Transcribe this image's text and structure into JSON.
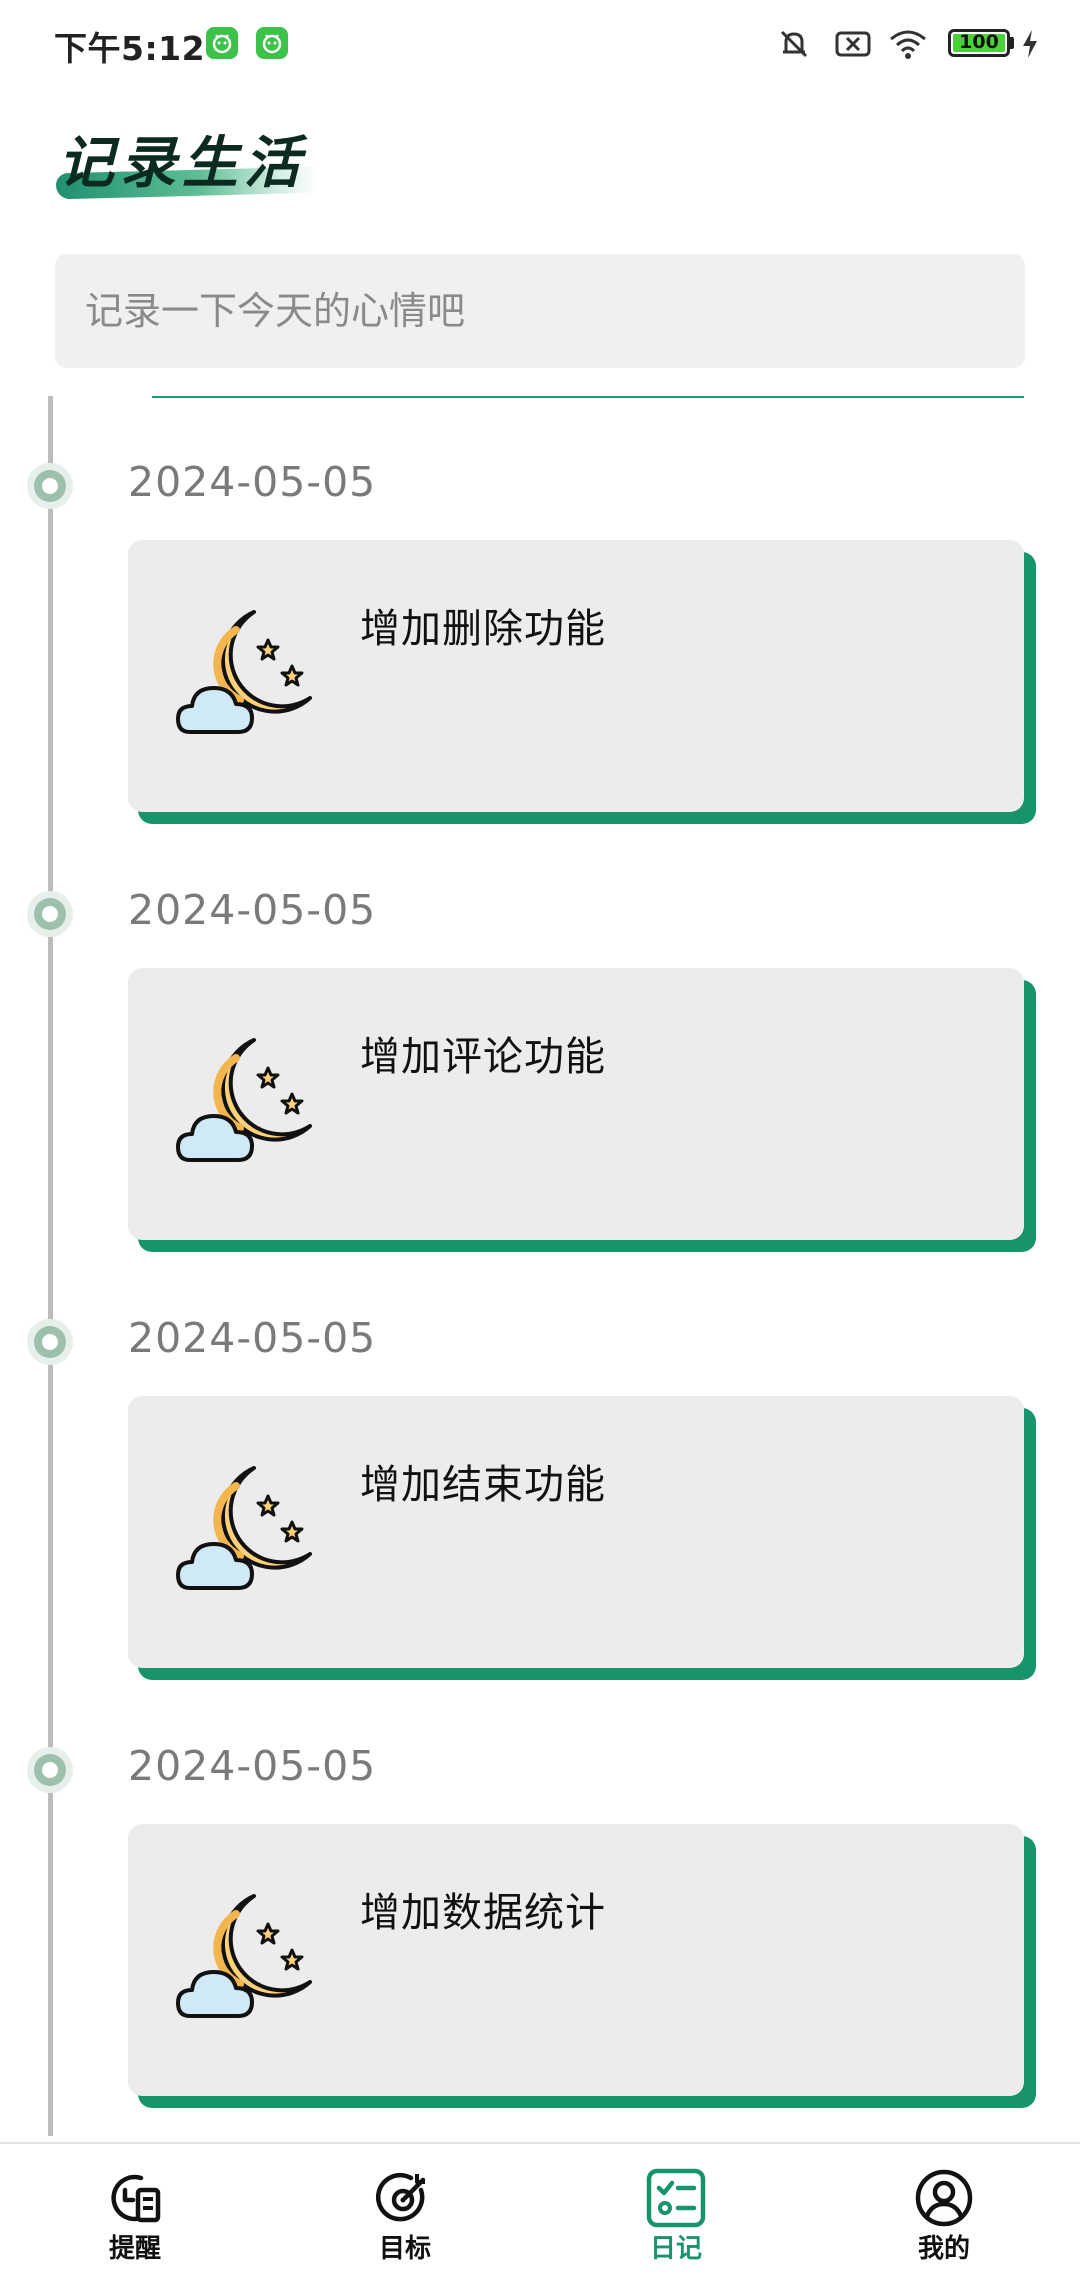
{
  "status_bar": {
    "time": "下午5:12",
    "battery": "100",
    "notification_icons": [
      "android-notification-icon",
      "android-notification-icon"
    ],
    "right_icons": [
      "mute-icon",
      "no-sim-icon",
      "wifi-icon",
      "battery-icon",
      "charging-icon"
    ]
  },
  "header": {
    "title": "记录生活"
  },
  "mood_input": {
    "placeholder": "记录一下今天的心情吧",
    "value": ""
  },
  "entries": [
    {
      "date": "2024-05-05",
      "title": "增加删除功能",
      "icon": "moon-cloud-icon"
    },
    {
      "date": "2024-05-05",
      "title": "增加评论功能",
      "icon": "moon-cloud-icon"
    },
    {
      "date": "2024-05-05",
      "title": "增加结束功能",
      "icon": "moon-cloud-icon"
    },
    {
      "date": "2024-05-05",
      "title": "增加数据统计",
      "icon": "moon-cloud-icon"
    }
  ],
  "bottom_nav": {
    "items": [
      {
        "label": "提醒",
        "icon": "reminder-icon",
        "active": false
      },
      {
        "label": "目标",
        "icon": "target-icon",
        "active": false
      },
      {
        "label": "日记",
        "icon": "diary-checklist-icon",
        "active": true
      },
      {
        "label": "我的",
        "icon": "user-icon",
        "active": false
      }
    ]
  },
  "colors": {
    "accent": "#17946c",
    "card_background": "#ececec",
    "timeline": "#bdbdbd",
    "title": "#0b2a20"
  }
}
